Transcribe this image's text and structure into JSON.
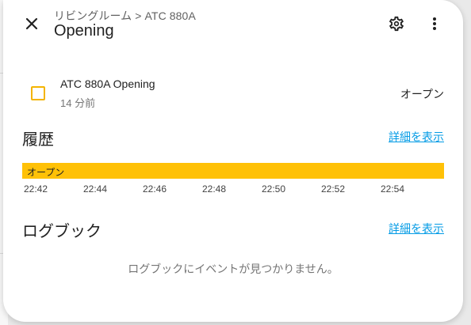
{
  "dialog": {
    "breadcrumb": "リビングルーム > ATC 880A",
    "title": "Opening"
  },
  "entity": {
    "name": "ATC 880A Opening",
    "last_changed": "14 分前",
    "state": "オープン"
  },
  "history": {
    "title": "履歴",
    "more_label": "詳細を表示",
    "timeline_label": "オープン",
    "ticks": [
      "22:42",
      "22:44",
      "22:46",
      "22:48",
      "22:50",
      "22:52",
      "22:54"
    ]
  },
  "logbook": {
    "title": "ログブック",
    "more_label": "詳細を表示",
    "empty_text": "ログブックにイベントが見つかりません。"
  },
  "colors": {
    "accent": "#039be5",
    "state_on": "#ffc107"
  },
  "icons": [
    "close-icon",
    "gear-icon",
    "more-vertical-icon",
    "checkbox-outline-icon"
  ]
}
